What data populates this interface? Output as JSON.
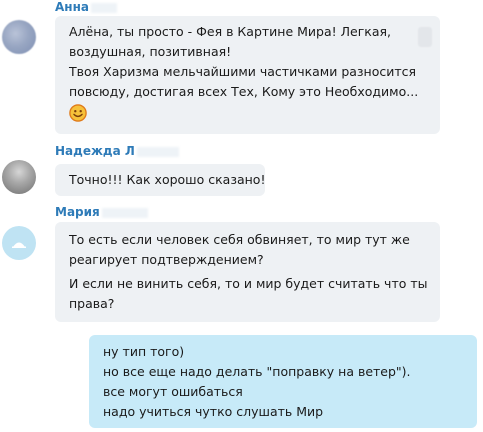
{
  "messages": [
    {
      "author": "Анна",
      "lines": [
        "Алёна, ты просто - Фея в Картине Мира! Легкая,",
        "воздушная, позитивная!",
        "Твоя Харизма мельчайшими частичками разносится",
        "повсюду, достигая всех Тех, Кому это Необходимо..."
      ],
      "emoji": "smile-emoji"
    },
    {
      "author": "Надежда Л",
      "lines": [
        "Точно!!! Как хорошо сказано!"
      ]
    },
    {
      "author": "Мария",
      "paragraphs": [
        [
          "То есть если человек себя обвиняет, то мир тут же",
          "реагирует подтверждением?"
        ],
        [
          "И если не винить себя, то и мир будет считать что ты",
          "права?"
        ]
      ]
    },
    {
      "author": "",
      "own": true,
      "lines": [
        "ну тип того)",
        "но все еще надо делать \"поправку на ветер\").",
        "все могут ошибаться",
        "надо учиться чутко слушать Мир"
      ]
    }
  ],
  "colors": {
    "author_name": "#2e7bb8",
    "incoming_bubble": "#eef1f4",
    "own_bubble": "#c7eaf8"
  }
}
